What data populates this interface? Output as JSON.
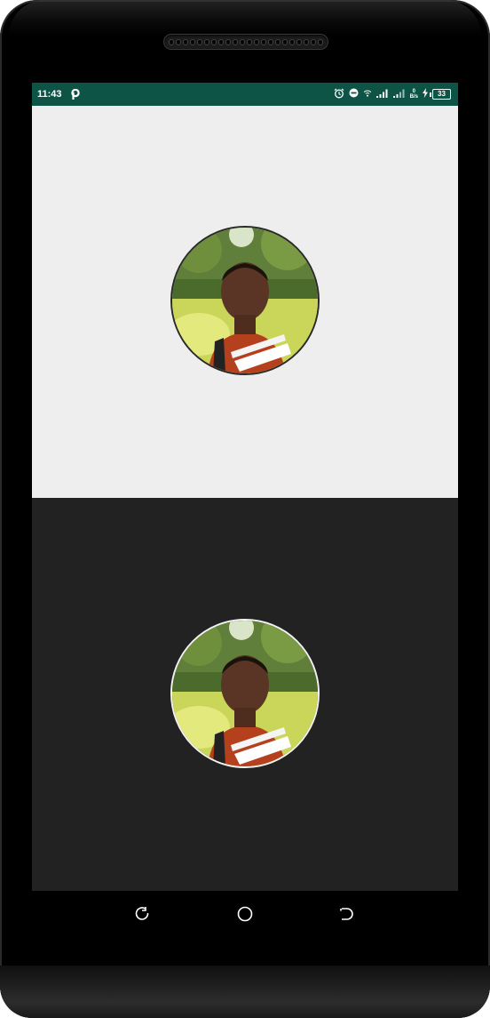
{
  "status_bar": {
    "time": "11:43",
    "net_speed_value": "0",
    "net_speed_unit": "B/s",
    "battery_level": "33"
  },
  "colors": {
    "status_bar_bg": "#0d5447",
    "light_panel_bg": "#eeeeee",
    "dark_panel_bg": "#222222",
    "light_avatar_border": "#2a2a2a",
    "dark_avatar_border": "#f2f2f2"
  },
  "panels": [
    {
      "theme": "light",
      "content": "circular-profile-photo"
    },
    {
      "theme": "dark",
      "content": "circular-profile-photo"
    }
  ],
  "status_icons": [
    "parking-app-icon",
    "alarm-icon",
    "do-not-disturb-icon",
    "wifi-icon",
    "signal-icon",
    "signal-icon",
    "charging-icon",
    "battery-icon"
  ],
  "nav_icons": [
    "back-icon",
    "home-icon",
    "recent-apps-icon"
  ]
}
